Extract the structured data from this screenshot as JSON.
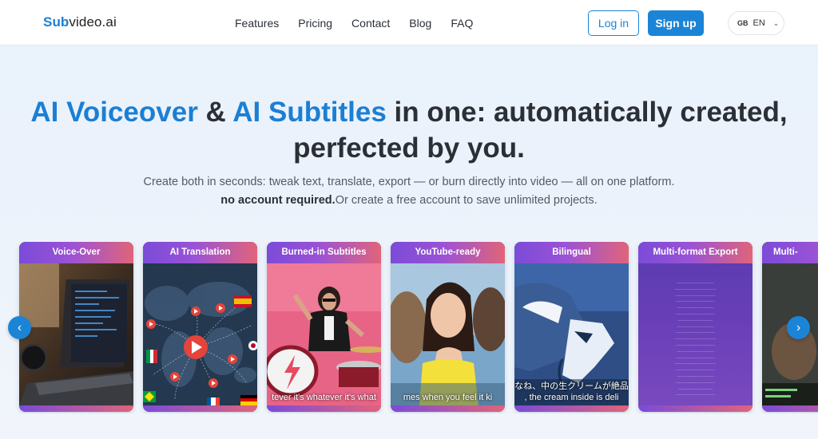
{
  "brand": {
    "accent": "Sub",
    "rest": "video.ai"
  },
  "nav": {
    "links": [
      "Features",
      "Pricing",
      "Contact",
      "Blog",
      "FAQ"
    ],
    "login_label": "Log in",
    "signup_label": "Sign up",
    "lang_flag": "GB",
    "lang_code": "EN"
  },
  "hero": {
    "title_part1": "AI Voiceover",
    "title_amp": " & ",
    "title_part2": "AI Subtitles",
    "title_part3": " in one: automatically created,",
    "title_line2": "perfected by you.",
    "subtitle": "Create both in seconds: tweak text, translate, export — or burn directly into video — all on one platform.",
    "note_bold": "no account required.",
    "note_rest": "Or create a free account to save unlimited projects."
  },
  "cards": [
    {
      "title": "Voice-Over",
      "caption": ""
    },
    {
      "title": "AI Translation",
      "caption": ""
    },
    {
      "title": "Burned-in Subtitles",
      "caption": "tever it's whatever it's what"
    },
    {
      "title": "YouTube-ready",
      "caption": "mes when you feel it ki"
    },
    {
      "title": "Bilingual",
      "caption": "なね、中の生クリームが絶品",
      "caption2": ", the cream inside is deli"
    },
    {
      "title": "Multi-format Export",
      "caption": ""
    },
    {
      "title": "Multi-",
      "caption": ""
    }
  ],
  "colors": {
    "accent": "#1b84d6",
    "card_gradient_start": "#7b4bd8",
    "card_gradient_end": "#e0647a"
  },
  "icons": {
    "prev": "chevron-left-icon",
    "next": "chevron-right-icon"
  }
}
